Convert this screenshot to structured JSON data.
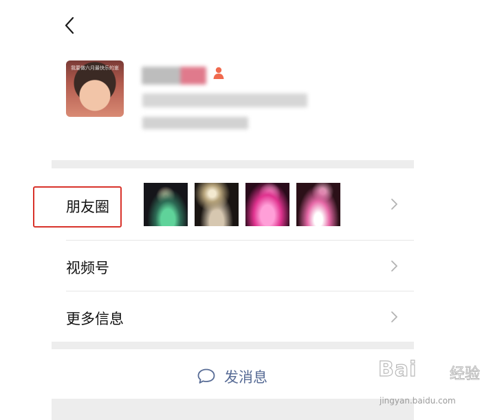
{
  "avatar": {
    "caption": "我要做六月最快乐的崽"
  },
  "menu": {
    "moments": {
      "label": "朋友圈"
    },
    "channels": {
      "label": "视频号"
    },
    "more_info": {
      "label": "更多信息"
    }
  },
  "actions": {
    "send_message": "发消息"
  },
  "watermark": {
    "brand": "Bai",
    "brand2": "经验",
    "url": "jingyan.baidu.com"
  },
  "colors": {
    "link_blue": "#576b95",
    "highlight_red": "#d8322a",
    "separator": "#ededed"
  },
  "icons": [
    "back-icon",
    "gender-icon",
    "chevron-right-icon",
    "chat-bubble-icon"
  ]
}
